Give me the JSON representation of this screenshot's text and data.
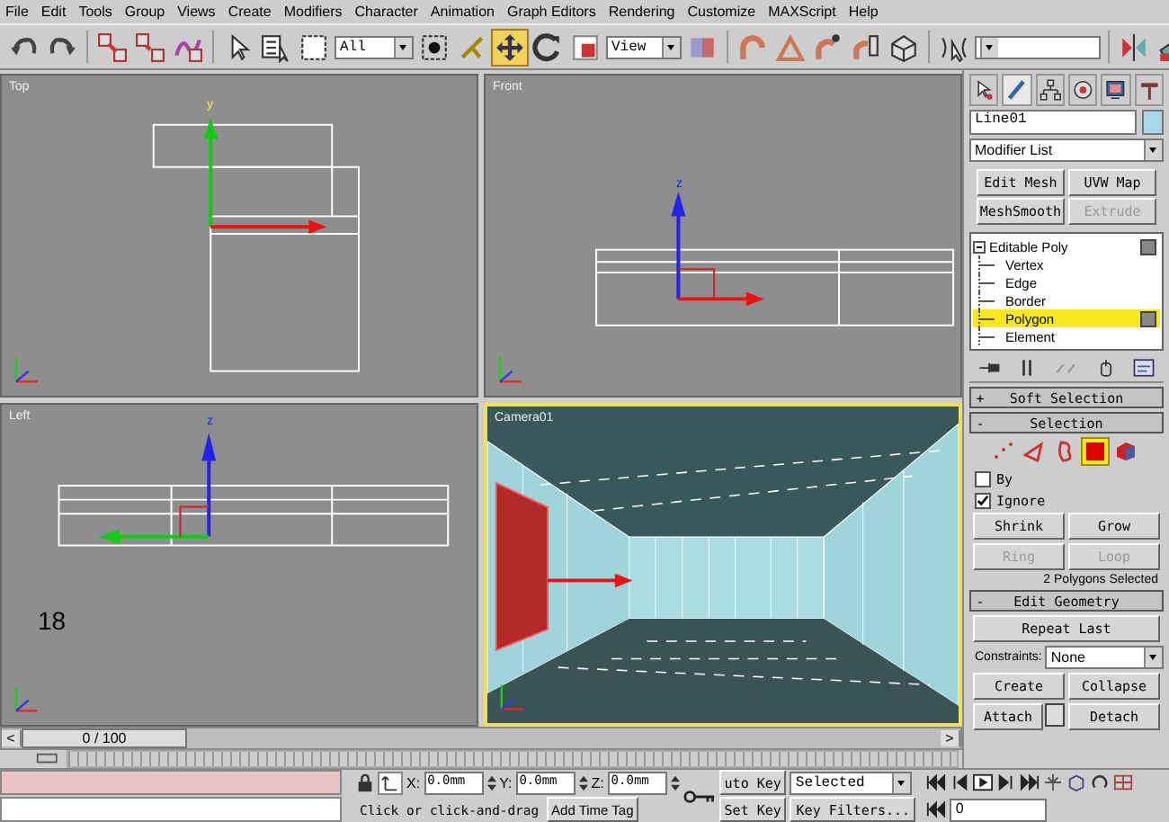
{
  "menu_bar": [
    "File",
    "Edit",
    "Tools",
    "Group",
    "Views",
    "Create",
    "Modifiers",
    "Character",
    "Animation",
    "Graph Editors",
    "Rendering",
    "Customize",
    "MAXScript",
    "Help"
  ],
  "toolbar": {
    "selection_filter": "All",
    "reference_coordinate_system": "View",
    "move_active": true
  },
  "viewports": [
    {
      "label": "Top",
      "kind": "top",
      "active": false,
      "gizmo_label": "y"
    },
    {
      "label": "Front",
      "kind": "front",
      "active": false,
      "gizmo_label": "z"
    },
    {
      "label": "Left",
      "kind": "left",
      "active": false,
      "gizmo_label": "z",
      "annotation": "18"
    },
    {
      "label": "Camera01",
      "kind": "camera",
      "active": true
    }
  ],
  "time_slider": {
    "prev": "<",
    "position": "0 / 100",
    "level": 0,
    "next": ">"
  },
  "command_panel": {
    "object_name": "Line01",
    "modifier_list": "Modifier List",
    "modifier_buttons": [
      {
        "label": "Edit Mesh",
        "disabled": false
      },
      {
        "label": "UVW Map",
        "disabled": false
      },
      {
        "label": "MeshSmooth",
        "disabled": false
      },
      {
        "label": "Extrude",
        "disabled": true
      }
    ],
    "stack": [
      {
        "label": "Editable Poly",
        "expanded": true,
        "selected": false,
        "children": [
          {
            "label": "Vertex",
            "selected": false
          },
          {
            "label": "Edge",
            "selected": false
          },
          {
            "label": "Border",
            "selected": false
          },
          {
            "label": "Polygon",
            "selected": true
          },
          {
            "label": "Element",
            "selected": false
          }
        ]
      }
    ],
    "soft_selection": {
      "sign": "+",
      "title": "Soft Selection"
    },
    "selection": {
      "sign": "-",
      "title": "Selection",
      "levels": [
        {
          "kind": "vertex",
          "selected": false
        },
        {
          "kind": "edge",
          "selected": false
        },
        {
          "kind": "border",
          "selected": false
        },
        {
          "kind": "polygon",
          "selected": true
        },
        {
          "kind": "element",
          "selected": false
        }
      ],
      "options": [
        {
          "label": "By",
          "checked": false
        },
        {
          "label": "Ignore",
          "checked": true
        }
      ],
      "buttons": [
        {
          "label": "Shrink",
          "disabled": false
        },
        {
          "label": "Grow",
          "disabled": false
        },
        {
          "label": "Ring",
          "disabled": true
        },
        {
          "label": "Loop",
          "disabled": true
        }
      ],
      "status": "2 Polygons Selected"
    },
    "edit_geometry": {
      "sign": "-",
      "title": "Edit Geometry",
      "repeat_last": "Repeat Last",
      "constraints_label": "Constraints:",
      "constraints_value": "None",
      "buttons": [
        {
          "label": "Create"
        },
        {
          "label": "Collapse"
        },
        {
          "label": "Attach"
        },
        {
          "label": "Detach"
        }
      ]
    }
  },
  "status_bar": {
    "coordinates": [
      {
        "axis": "X:",
        "value": "0.0mm"
      },
      {
        "axis": "Y:",
        "value": "0.0mm"
      },
      {
        "axis": "Z:",
        "value": "0.0mm"
      }
    ],
    "auto_key": "uto Key",
    "key_mode": "Selected",
    "set_key": "Set Key",
    "key_filters": "Key Filters...",
    "prompt": "Click or click-and-drag",
    "add_time_tag": "Add Time Tag",
    "current_frame": "0"
  }
}
